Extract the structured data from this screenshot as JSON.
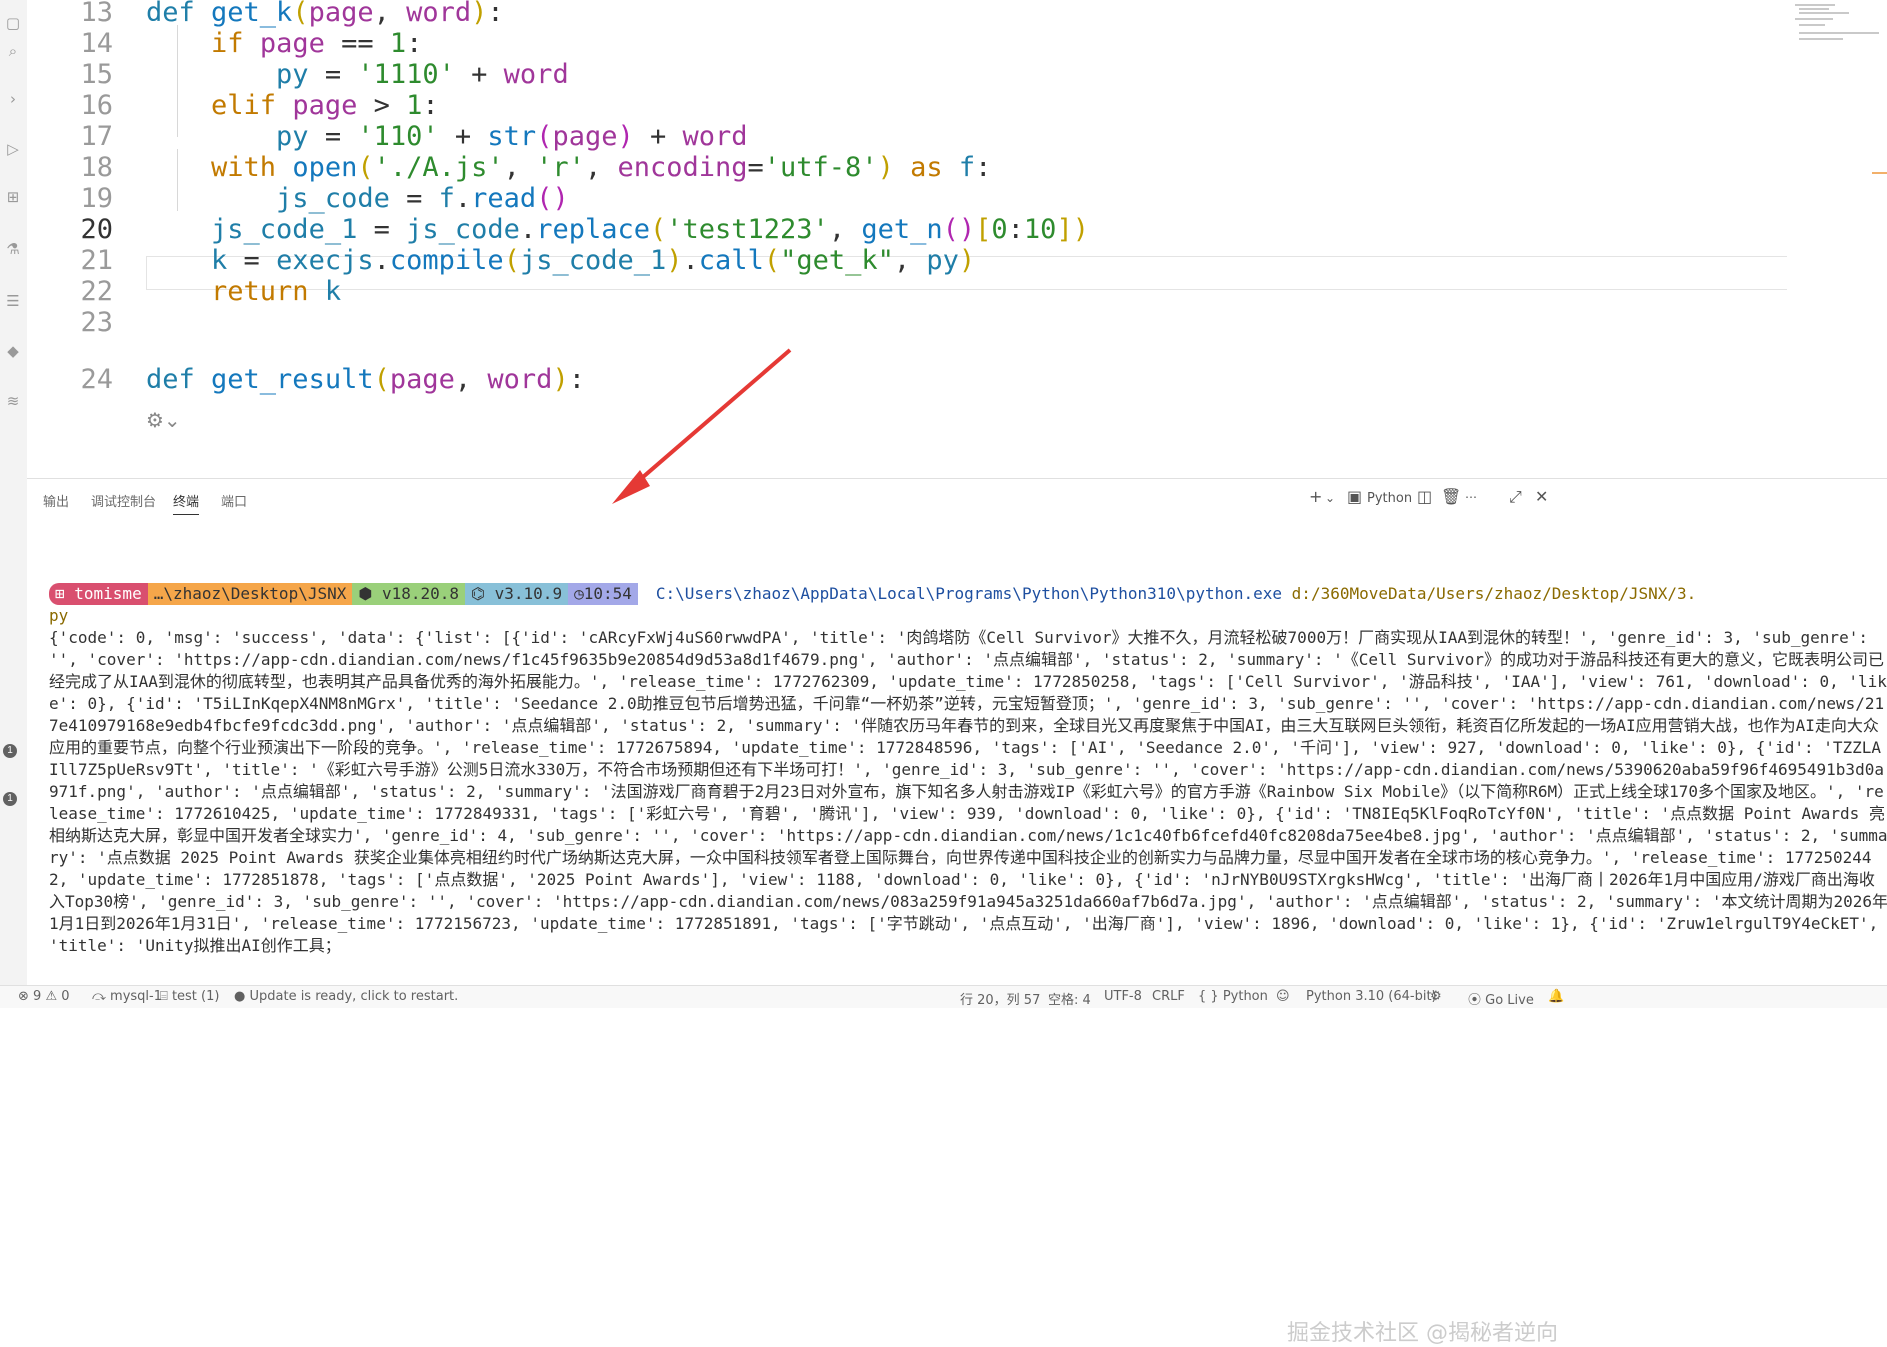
{
  "editor": {
    "lines": [
      {
        "num": "13",
        "tokens": [
          [
            "kw",
            "def "
          ],
          [
            "fn",
            "get_k"
          ],
          [
            "br",
            "("
          ],
          [
            "param",
            "page"
          ],
          [
            "op",
            ", "
          ],
          [
            "param",
            "word"
          ],
          [
            "br",
            ")"
          ],
          [
            "op",
            ":"
          ]
        ]
      },
      {
        "num": "14",
        "tokens": [
          [
            "op",
            "    "
          ],
          [
            "kw2",
            "if "
          ],
          [
            "param",
            "page"
          ],
          [
            "op",
            " == "
          ],
          [
            "num",
            "1"
          ],
          [
            "op",
            ":"
          ]
        ]
      },
      {
        "num": "15",
        "tokens": [
          [
            "op",
            "        "
          ],
          [
            "var",
            "py"
          ],
          [
            "op",
            " = "
          ],
          [
            "str",
            "'1110'"
          ],
          [
            "op",
            " + "
          ],
          [
            "param",
            "word"
          ]
        ]
      },
      {
        "num": "16",
        "tokens": [
          [
            "op",
            "    "
          ],
          [
            "kw2",
            "elif "
          ],
          [
            "param",
            "page"
          ],
          [
            "op",
            " > "
          ],
          [
            "num",
            "1"
          ],
          [
            "op",
            ":"
          ]
        ]
      },
      {
        "num": "17",
        "tokens": [
          [
            "op",
            "        "
          ],
          [
            "var",
            "py"
          ],
          [
            "op",
            " = "
          ],
          [
            "str",
            "'110'"
          ],
          [
            "op",
            " + "
          ],
          [
            "fn",
            "str"
          ],
          [
            "br2",
            "("
          ],
          [
            "param",
            "page"
          ],
          [
            "br2",
            ")"
          ],
          [
            "op",
            " + "
          ],
          [
            "param",
            "word"
          ]
        ]
      },
      {
        "num": "18",
        "tokens": [
          [
            "op",
            "    "
          ],
          [
            "kw2",
            "with "
          ],
          [
            "fn",
            "open"
          ],
          [
            "br",
            "("
          ],
          [
            "str",
            "'./A.js'"
          ],
          [
            "op",
            ", "
          ],
          [
            "str",
            "'r'"
          ],
          [
            "op",
            ", "
          ],
          [
            "param",
            "encoding"
          ],
          [
            "op",
            "="
          ],
          [
            "str",
            "'utf-8'"
          ],
          [
            "br",
            ")"
          ],
          [
            "kw2",
            " as "
          ],
          [
            "var",
            "f"
          ],
          [
            "op",
            ":"
          ]
        ]
      },
      {
        "num": "19",
        "tokens": [
          [
            "op",
            "        "
          ],
          [
            "var",
            "js_code"
          ],
          [
            "op",
            " = "
          ],
          [
            "var",
            "f"
          ],
          [
            "op",
            "."
          ],
          [
            "fn",
            "read"
          ],
          [
            "br2",
            "()"
          ]
        ]
      },
      {
        "num": "20",
        "tokens": [
          [
            "op",
            "    "
          ],
          [
            "var",
            "js_code_1"
          ],
          [
            "op",
            " = "
          ],
          [
            "var",
            "js_code"
          ],
          [
            "op",
            "."
          ],
          [
            "fn",
            "replace"
          ],
          [
            "br",
            "("
          ],
          [
            "str",
            "'test1223'"
          ],
          [
            "op",
            ", "
          ],
          [
            "fn",
            "get_n"
          ],
          [
            "br2",
            "()"
          ],
          [
            "br",
            "["
          ],
          [
            "num",
            "0"
          ],
          [
            "op",
            ":"
          ],
          [
            "num",
            "10"
          ],
          [
            "br",
            "]"
          ],
          [
            "br",
            ")"
          ]
        ]
      },
      {
        "num": "21",
        "tokens": [
          [
            "op",
            "    "
          ],
          [
            "var",
            "k"
          ],
          [
            "op",
            " = "
          ],
          [
            "var",
            "execjs"
          ],
          [
            "op",
            "."
          ],
          [
            "fn",
            "compile"
          ],
          [
            "br",
            "("
          ],
          [
            "var",
            "js_code_1"
          ],
          [
            "br",
            ")"
          ],
          [
            "op",
            "."
          ],
          [
            "fn",
            "call"
          ],
          [
            "br",
            "("
          ],
          [
            "str",
            "\"get_k\""
          ],
          [
            "op",
            ", "
          ],
          [
            "var",
            "py"
          ],
          [
            "br",
            ")"
          ]
        ]
      },
      {
        "num": "22",
        "tokens": [
          [
            "op",
            "    "
          ],
          [
            "kw2",
            "return "
          ],
          [
            "var",
            "k"
          ]
        ]
      },
      {
        "num": "23",
        "tokens": []
      },
      {
        "num": "24",
        "tokens": [
          [
            "kw",
            "def "
          ],
          [
            "fn",
            "get_result"
          ],
          [
            "br",
            "("
          ],
          [
            "param",
            "page"
          ],
          [
            "op",
            ", "
          ],
          [
            "param",
            "word"
          ],
          [
            "br",
            ")"
          ],
          [
            "op",
            ":"
          ]
        ]
      }
    ],
    "active_line": "20"
  },
  "panel": {
    "tabs": [
      "输出",
      "调试控制台",
      "终端",
      "端口"
    ],
    "active_tab": "终端",
    "toolbar": {
      "add": "+",
      "add_dropdown": "⌄",
      "terminal_name": "Python"
    }
  },
  "prompt": {
    "user": "tomisme",
    "path": "…\\zhaoz\\Desktop\\JSNX",
    "node": "v18.20.8",
    "python": "v3.10.9",
    "time": "10:54",
    "command": "C:\\Users\\zhaoz\\AppData\\Local\\Programs\\Python\\Python310\\python.exe",
    "script": "d:/360MoveData/Users/zhaoz/Desktop/JSNX/3.",
    "script_cont": "py"
  },
  "output": "{'code': 0, 'msg': 'success', 'data': {'list': [{'id': 'cARcyFxWj4uS60rwwdPA', 'title': '肉鸽塔防《Cell Survivor》大推不久，月流轻松破7000万！厂商实现从IAA到混休的转型！', 'genre_id': 3, 'sub_genre': '', 'cover': 'https://app-cdn.diandian.com/news/f1c45f9635b9e20854d9d53a8d1f4679.png', 'author': '点点编辑部', 'status': 2, 'summary': '《Cell Survivor》的成功对于游品科技还有更大的意义，它既表明公司已经完成了从IAA到混休的彻底转型，也表明其产品具备优秀的海外拓展能力。', 'release_time': 1772762309, 'update_time': 1772850258, 'tags': ['Cell Survivor', '游品科技', 'IAA'], 'view': 761, 'download': 0, 'like': 0}, {'id': 'T5iLInKqepX4NM8nMGrx', 'title': 'Seedance 2.0助推豆包节后增势迅猛，千问靠“一杯奶茶”逆转，元宝短暂登顶；', 'genre_id': 3, 'sub_genre': '', 'cover': 'https://app-cdn.diandian.com/news/217e410979168e9edb4fbcfe9fcdc3dd.png', 'author': '点点编辑部', 'status': 2, 'summary': '伴随农历马年春节的到来，全球目光又再度聚焦于中国AI，由三大互联网巨头领衔，耗资百亿所发起的一场AI应用营销大战，也作为AI走向大众应用的重要节点，向整个行业预演出下一阶段的竞争。', 'release_time': 1772675894, 'update_time': 1772848596, 'tags': ['AI', 'Seedance 2.0', '千问'], 'view': 927, 'download': 0, 'like': 0}, {'id': 'TZZLAIll7Z5pUeRsv9Tt', 'title': '《彩虹六号手游》公测5日流水330万，不符合市场预期但还有下半场可打！', 'genre_id': 3, 'sub_genre': '', 'cover': 'https://app-cdn.diandian.com/news/5390620aba59f96f4695491b3d0a971f.png', 'author': '点点编辑部', 'status': 2, 'summary': '法国游戏厂商育碧于2月23日对外宣布，旗下知名多人射击游戏IP《彩虹六号》的官方手游《Rainbow Six Mobile》（以下简称R6M）正式上线全球170多个国家及地区。', 'release_time': 1772610425, 'update_time': 1772849331, 'tags': ['彩虹六号', '育碧', '腾讯'], 'view': 939, 'download': 0, 'like': 0}, {'id': 'TN8IEq5KlFoqRoTcYf0N', 'title': '点点数据 Point Awards 亮相纳斯达克大屏，彰显中国开发者全球实力', 'genre_id': 4, 'sub_genre': '', 'cover': 'https://app-cdn.diandian.com/news/1c1c40fb6fcefd40fc8208da75ee4be8.jpg', 'author': '点点编辑部', 'status': 2, 'summary': '点点数据 2025 Point Awards 获奖企业集体亮相纽约时代广场纳斯达克大屏，一众中国科技领军者登上国际舞台，向世界传递中国科技企业的创新实力与品牌力量，尽显中国开发者在全球市场的核心竞争力。', 'release_time': 1772502442, 'update_time': 1772851878, 'tags': ['点点数据', '2025 Point Awards'], 'view': 1188, 'download': 0, 'like': 0}, {'id': 'nJrNYB0U9STXrgksHWcg', 'title': '出海厂商丨2026年1月中国应用/游戏厂商出海收入Top30榜', 'genre_id': 3, 'sub_genre': '', 'cover': 'https://app-cdn.diandian.com/news/083a259f91a945a3251da660af7b6d7a.jpg', 'author': '点点编辑部', 'status': 2, 'summary': '本文统计周期为2026年1月1日到2026年1月31日', 'release_time': 1772156723, 'update_time': 1772851891, 'tags': ['字节跳动', '点点互动', '出海厂商'], 'view': 1896, 'download': 0, 'like': 1}, {'id': 'Zruw1elrgulT9Y4eCkET', 'title': 'Unity拟推出AI创作工具；",
  "status": {
    "errors": "9",
    "warnings": "0",
    "db": "mysql-1",
    "db_test": "test (1)",
    "update": "Update is ready, click to restart.",
    "position": "行 20，列 57",
    "spaces": "空格: 4",
    "encoding": "UTF-8",
    "eol": "CRLF",
    "language": "Python",
    "interpreter": "Python 3.10 (64-bit)",
    "golive": "Go Live"
  },
  "watermark": "掘金技术社区 @揭秘者逆向",
  "colors": {
    "accent": "#1f7ea8",
    "arrow": "#e53935"
  }
}
